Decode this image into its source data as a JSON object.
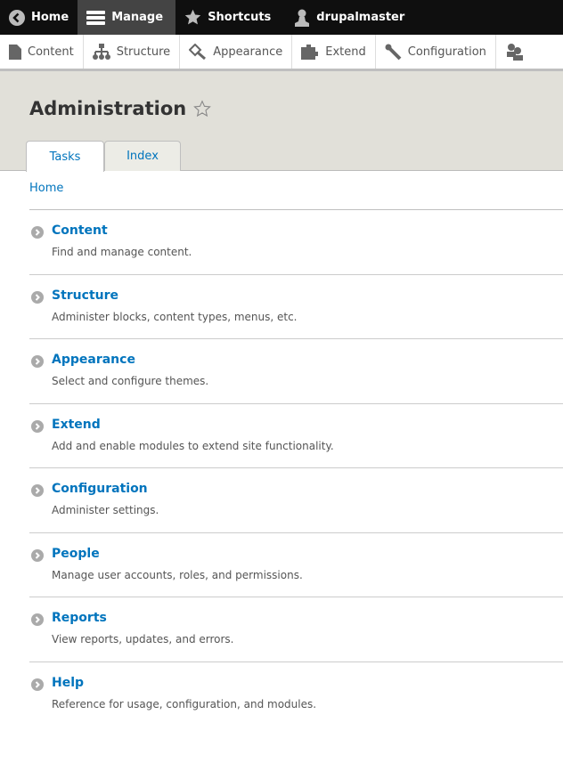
{
  "toolbar": {
    "items": [
      {
        "label": "Home",
        "icon": "back-circle-icon"
      },
      {
        "label": "Manage",
        "icon": "hamburger-icon",
        "active": true
      },
      {
        "label": "Shortcuts",
        "icon": "star-icon"
      },
      {
        "label": "drupalmaster",
        "icon": "user-icon"
      }
    ]
  },
  "tray": {
    "items": [
      {
        "label": "Content",
        "icon": "file-icon"
      },
      {
        "label": "Structure",
        "icon": "sitemap-icon"
      },
      {
        "label": "Appearance",
        "icon": "paintbrush-icon"
      },
      {
        "label": "Extend",
        "icon": "puzzle-icon"
      },
      {
        "label": "Configuration",
        "icon": "wrench-icon"
      },
      {
        "label": "",
        "icon": "people-icon"
      }
    ]
  },
  "page": {
    "title": "Administration",
    "tabs": [
      {
        "label": "Tasks",
        "active": true
      },
      {
        "label": "Index"
      }
    ],
    "breadcrumb": "Home"
  },
  "items": [
    {
      "title": "Content",
      "desc": "Find and manage content."
    },
    {
      "title": "Structure",
      "desc": "Administer blocks, content types, menus, etc."
    },
    {
      "title": "Appearance",
      "desc": "Select and configure themes."
    },
    {
      "title": "Extend",
      "desc": "Add and enable modules to extend site functionality."
    },
    {
      "title": "Configuration",
      "desc": "Administer settings."
    },
    {
      "title": "People",
      "desc": "Manage user accounts, roles, and permissions."
    },
    {
      "title": "Reports",
      "desc": "View reports, updates, and errors."
    },
    {
      "title": "Help",
      "desc": "Reference for usage, configuration, and modules."
    }
  ],
  "colors": {
    "link": "#0074bd",
    "toolbar": "#0f0f0f",
    "header": "#e1e0d9"
  }
}
